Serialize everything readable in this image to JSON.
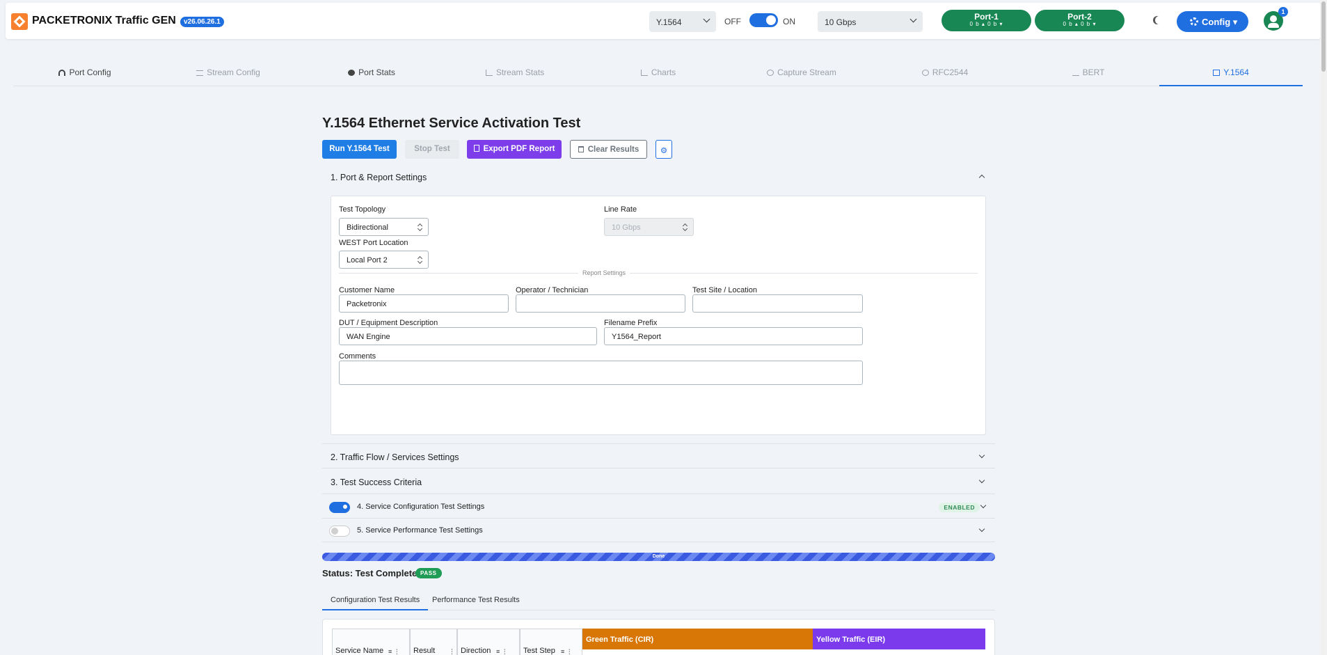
{
  "header": {
    "brand": "PACKETRONIX Traffic GEN",
    "version": "v26.06.26.1",
    "mode_select": "Y.1564",
    "off_label": "OFF",
    "on_label": "ON",
    "rate_select": "10 Gbps",
    "ports": [
      {
        "name": "Port-1",
        "status": "0 b ▴ 0 b ▾"
      },
      {
        "name": "Port-2",
        "status": "0 b ▴ 0 b ▾"
      }
    ],
    "config_label": "Config",
    "users_count": "1"
  },
  "tabs": [
    {
      "label": "Port Config"
    },
    {
      "label": "Stream Config"
    },
    {
      "label": "Port Stats"
    },
    {
      "label": "Stream Stats"
    },
    {
      "label": "Charts"
    },
    {
      "label": "Capture Stream"
    },
    {
      "label": "RFC2544"
    },
    {
      "label": "BERT"
    },
    {
      "label": "Y.1564"
    }
  ],
  "page": {
    "title": "Y.1564 Ethernet Service Activation Test",
    "buttons": {
      "run": "Run Y.1564 Test",
      "stop": "Stop Test",
      "export": "Export PDF Report",
      "clear": "Clear Results"
    }
  },
  "sections": {
    "s1": "1. Port & Report Settings",
    "s2": "2. Traffic Flow / Services Settings",
    "s3": "3. Test Success Criteria",
    "s4": "4. Service Configuration Test Settings",
    "s5": "5. Service Performance Test Settings",
    "s4_badge": "ENABLED"
  },
  "form": {
    "topology_label": "Test Topology",
    "topology_value": "Bidirectional",
    "line_rate_label": "Line Rate",
    "line_rate_value": "10 Gbps",
    "west_port_label": "WEST Port Location",
    "west_port_value": "Local Port 2",
    "report_settings": "Report Settings",
    "customer_label": "Customer Name",
    "customer_value": "Packetronix",
    "operator_label": "Operator / Technician",
    "operator_value": "",
    "site_label": "Test Site / Location",
    "site_value": "",
    "dut_label": "DUT / Equipment Description",
    "dut_value": "WAN Engine",
    "prefix_label": "Filename Prefix",
    "prefix_value": "Y1564_Report",
    "comments_label": "Comments",
    "comments_value": ""
  },
  "results": {
    "progress_label": "Done",
    "progress_value": 1.0,
    "status": "Status: Test Complete",
    "badge": "PASS",
    "tabs": [
      "Configuration Test Results",
      "Performance Test Results"
    ],
    "columns": [
      "Service Name",
      "Result",
      "Direction",
      "Test Step"
    ],
    "groups": [
      "Green Traffic (CIR)",
      "Yellow Traffic (EIR)"
    ]
  },
  "colors": {
    "primary": "#1f6fe0",
    "success": "#198754",
    "export": "#7d3dea",
    "green_group": "#d97706",
    "yellow_group": "#7c3aed"
  }
}
